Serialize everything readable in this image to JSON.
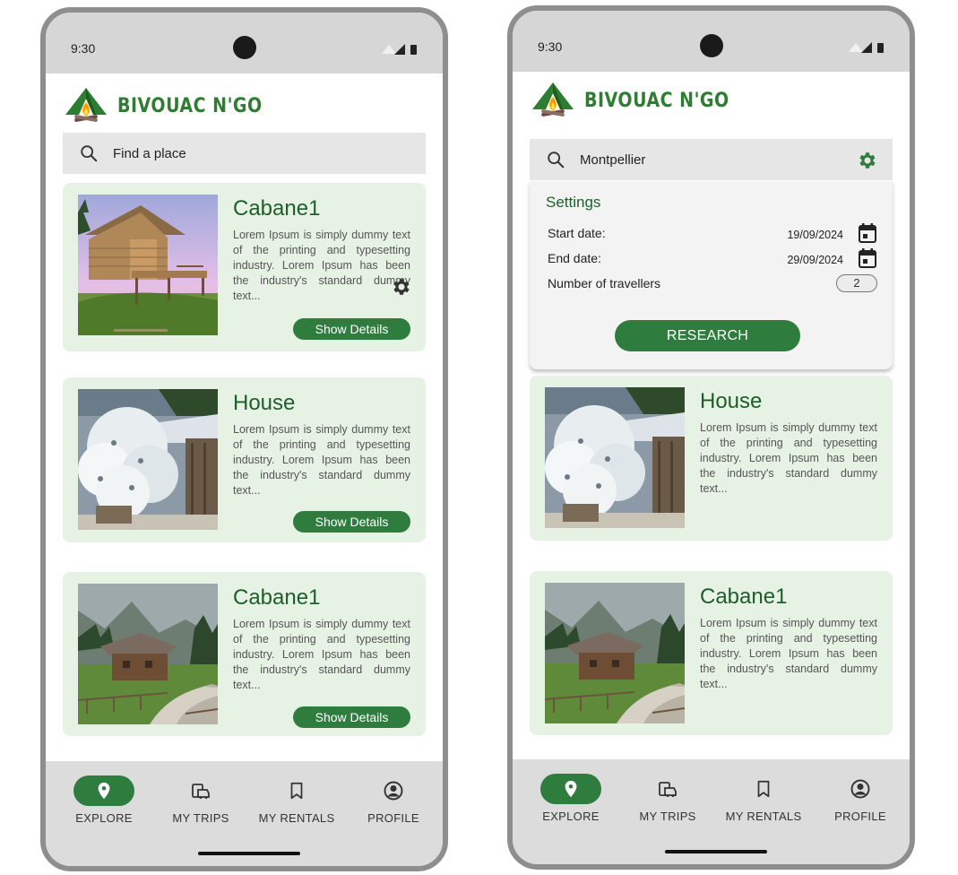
{
  "status": {
    "time": "9:30"
  },
  "brand": {
    "name": "BIVOUAC N'GO"
  },
  "left_screen": {
    "search": {
      "placeholder": "Find a place"
    },
    "cards": [
      {
        "title": "Cabane1",
        "description": "Lorem Ipsum is simply dummy text of the printing and typesetting industry. Lorem Ipsum has been the industry's standard dummy text...",
        "button": "Show Details"
      },
      {
        "title": "House",
        "description": "Lorem Ipsum is simply dummy text of the printing and typesetting industry. Lorem Ipsum has been the industry's standard dummy text...",
        "button": "Show Details"
      },
      {
        "title": "Cabane1",
        "description": "Lorem Ipsum is simply dummy text of the printing and typesetting industry. Lorem Ipsum has been the industry's standard dummy text...",
        "button": "Show Details"
      }
    ]
  },
  "right_screen": {
    "search": {
      "value": "Montpellier"
    },
    "settings": {
      "title": "Settings",
      "start_label": "Start date:",
      "start_value": "19/09/2024",
      "end_label": "End date:",
      "end_value": "29/09/2024",
      "travellers_label": "Number of travellers",
      "travellers_value": "2",
      "research_button": "RESEARCH"
    },
    "cards": [
      {
        "title": "House",
        "description": "Lorem Ipsum is simply dummy text of the printing and typesetting industry. Lorem Ipsum has been the industry's standard dummy text..."
      },
      {
        "title": "Cabane1",
        "description": "Lorem Ipsum is simply dummy text of the printing and typesetting industry. Lorem Ipsum has been the industry's standard dummy text..."
      }
    ]
  },
  "nav": {
    "items": [
      {
        "label": "EXPLORE",
        "icon": "location-pin-icon",
        "active": true
      },
      {
        "label": "MY TRIPS",
        "icon": "car-suitcase-icon",
        "active": false
      },
      {
        "label": "MY RENTALS",
        "icon": "bookmark-icon",
        "active": false
      },
      {
        "label": "PROFILE",
        "icon": "account-circle-icon",
        "active": false
      }
    ]
  },
  "colors": {
    "brand_green": "#2e7d3e",
    "card_bg": "#e6f2e3",
    "title_green": "#1e5e2a"
  }
}
